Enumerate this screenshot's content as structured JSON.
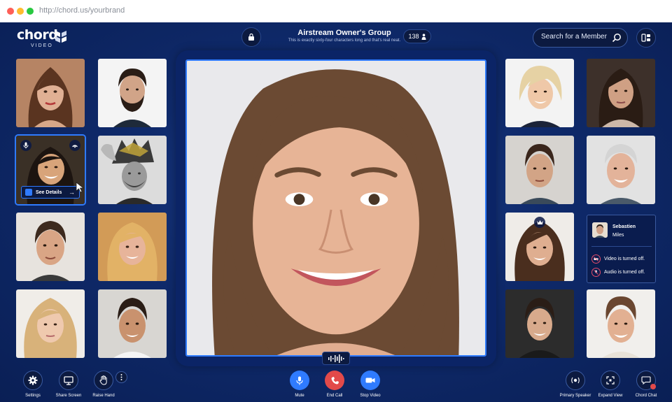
{
  "browser": {
    "url": "http://chord.us/yourbrand"
  },
  "brand": {
    "name": "chord",
    "sub": "VIDEO"
  },
  "header": {
    "group_title": "Airstream Owner's Group",
    "group_subtitle": "This is exactly sixty-four characters long and that's real neat.",
    "participant_count": "138"
  },
  "search": {
    "placeholder": "Search for a Member"
  },
  "selected_tile": {
    "details_label": "See Details"
  },
  "info_card": {
    "first_name": "Sebastien",
    "last_name": "Miles",
    "video_status": "Video is turned off.",
    "audio_status": "Audio is turned off."
  },
  "controls": {
    "settings": "Settings",
    "share_screen": "Share Screen",
    "raise_hand": "Raise Hand",
    "mute": "Mute",
    "end_call": "End Call",
    "stop_video": "Stop Video",
    "primary_speaker": "Primary Speaker",
    "expand_view": "Expand View",
    "chord_chat": "Chord Chat"
  },
  "colors": {
    "background": "#0f2a6b",
    "accent": "#2f7bff",
    "end_call": "#e24a4a"
  }
}
